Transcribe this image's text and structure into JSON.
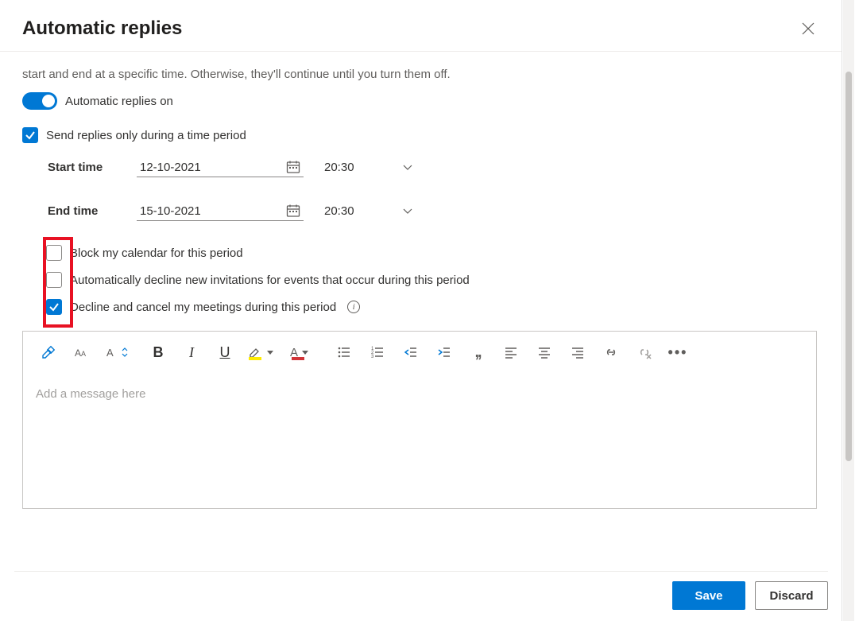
{
  "header": {
    "title": "Automatic replies"
  },
  "intro": "start and end at a specific time. Otherwise, they'll continue until you turn them off.",
  "toggle": {
    "label": "Automatic replies on",
    "on": true
  },
  "time_period": {
    "checkbox_label": "Send replies only during a time period",
    "checked": true,
    "start_label": "Start time",
    "start_date": "12-10-2021",
    "start_time": "20:30",
    "end_label": "End time",
    "end_date": "15-10-2021",
    "end_time": "20:30"
  },
  "options": {
    "block_calendar": {
      "label": "Block my calendar for this period",
      "checked": false
    },
    "decline_new": {
      "label": "Automatically decline new invitations for events that occur during this period",
      "checked": false
    },
    "decline_cancel": {
      "label": "Decline and cancel my meetings during this period",
      "checked": true
    }
  },
  "editor": {
    "placeholder": "Add a message here"
  },
  "footer": {
    "save": "Save",
    "discard": "Discard"
  },
  "icons": {
    "calendar": "calendar-icon",
    "chevron_down": "chevron-down-icon",
    "close": "close-icon",
    "info": "i"
  },
  "colors": {
    "accent": "#0078d4",
    "highlight_border": "#e81123",
    "text_highlight": "#ffeb00",
    "font_color": "#d13438"
  }
}
